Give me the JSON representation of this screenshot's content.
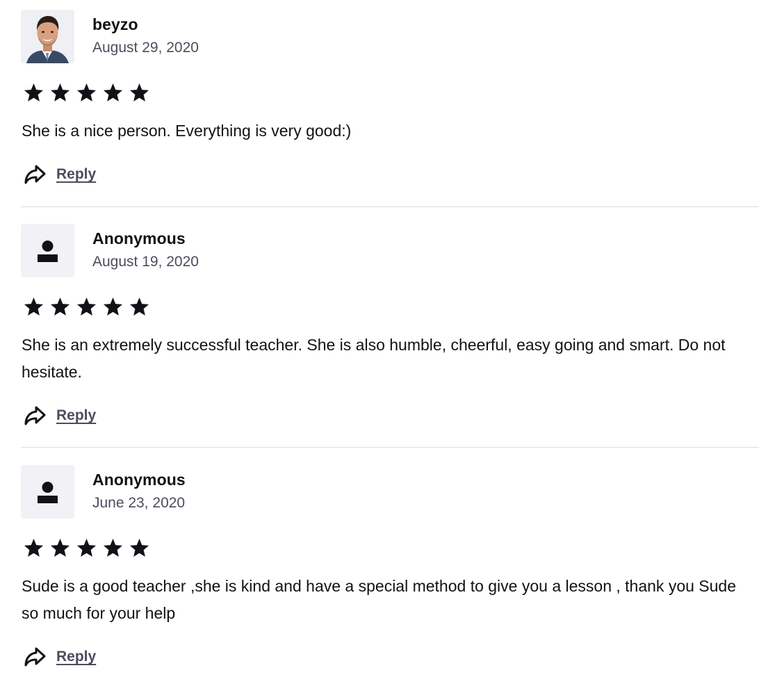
{
  "reviews": [
    {
      "name": "beyzo",
      "date": "August 29, 2020",
      "avatar": "photo",
      "rating": 5,
      "text": "She is a nice person. Everything is very good:)",
      "reply_label": "Reply"
    },
    {
      "name": "Anonymous",
      "date": "August 19, 2020",
      "avatar": "anonymous-user-icon",
      "rating": 5,
      "text": "She is an extremely successful teacher. She is also humble, cheerful, easy going and smart. Do not hesitate.",
      "reply_label": "Reply"
    },
    {
      "name": "Anonymous",
      "date": "June 23, 2020",
      "avatar": "anonymous-user-icon",
      "rating": 5,
      "text": "Sude is a good teacher ,she is kind and have a special method to give you a lesson , thank you Sude so much for your help",
      "reply_label": "Reply"
    }
  ],
  "colors": {
    "text": "#121117",
    "muted": "#4d4c5c",
    "avatar_bg": "#f2f2f6",
    "divider": "#dcdce5"
  }
}
